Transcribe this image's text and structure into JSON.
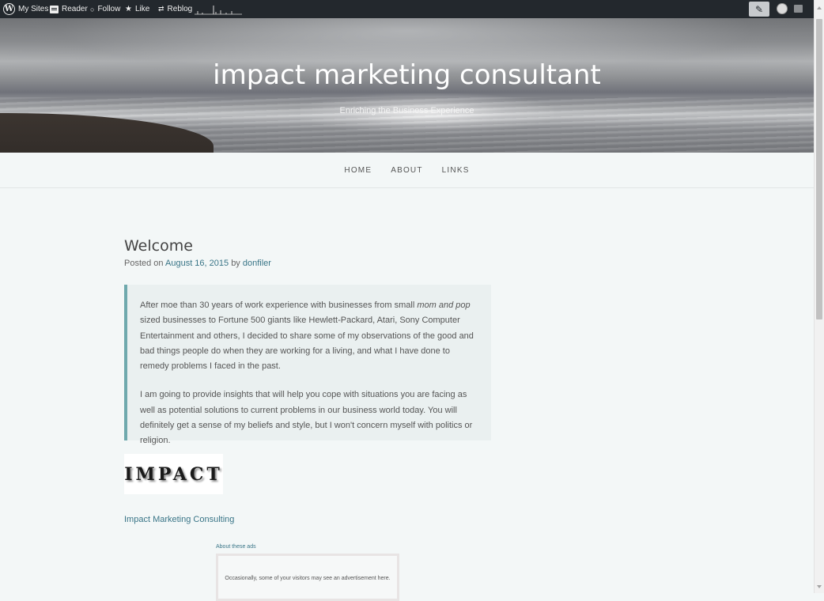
{
  "adminbar": {
    "my_sites": "My Sites",
    "reader": "Reader",
    "follow": "Follow",
    "like": "Like",
    "reblog": "Reblog",
    "icons": [
      "wordpress-icon",
      "reader-icon",
      "follow-icon",
      "star-icon",
      "reblog-icon",
      "stats-sparkline",
      "write-icon",
      "avatar",
      "notifications-icon"
    ]
  },
  "header": {
    "site_title": "impact marketing consultant",
    "site_description": "Enriching the Business Experience"
  },
  "nav": {
    "items": [
      {
        "label": "HOME"
      },
      {
        "label": "ABOUT"
      },
      {
        "label": "LINKS"
      }
    ]
  },
  "post": {
    "title": "Welcome",
    "meta_prefix": "Posted on",
    "date": "August 16, 2015",
    "meta_by": "by",
    "author": "donfiler",
    "quote": {
      "p1_a": "After moe than 30 years of work experience with businesses from small ",
      "p1_em": "mom and pop",
      "p1_b": " sized businesses to Fortune 500 giants like Hewlett-Packard, Atari, Sony Computer Entertainment and others, I decided to share some of my observations of the good and bad things people do when they are working for a living, and what I have done to remedy problems I faced in the past.",
      "p2": "I am going to provide insights that will help you cope with situations you are facing as well as potential solutions to current problems in our business world today. You will definitely get a sense of my beliefs and style, but I won't concern myself with politics or religion."
    },
    "logo_text": "IMPACT",
    "link_text": "Impact Marketing Consulting"
  },
  "ads": {
    "label": "About these ads",
    "message": "Occasionally, some of your visitors may see an advertisement here."
  },
  "colors": {
    "adminbar_bg": "#23282d",
    "page_bg": "#f3f7f7",
    "accent_link": "#397587",
    "quote_border": "#6fa9ad"
  }
}
